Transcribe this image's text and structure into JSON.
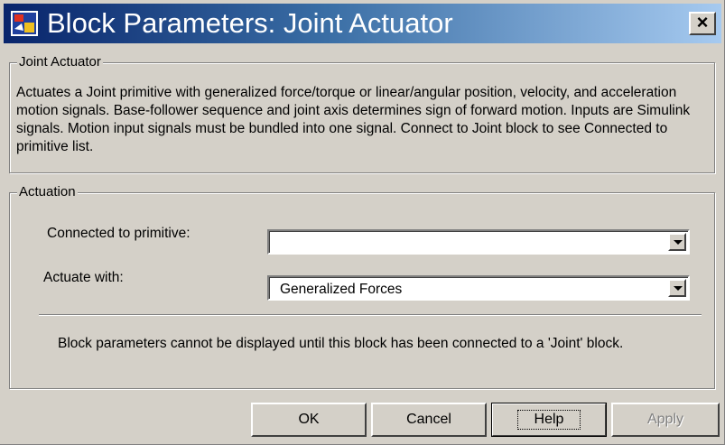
{
  "window": {
    "title": "Block Parameters: Joint Actuator",
    "close_label": "×",
    "title_bar_color": "#08246b"
  },
  "description_group": {
    "legend": "Joint Actuator",
    "text": "Actuates a Joint primitive with generalized force/torque or linear/angular position, velocity, and acceleration motion signals. Base-follower sequence and joint axis determines sign of forward motion. Inputs are Simulink signals. Motion input signals must be bundled into one signal. Connect to Joint block to see Connected to primitive list."
  },
  "actuation_group": {
    "legend": "Actuation",
    "connected_label": "Connected to primitive:",
    "connected_value": "",
    "actuate_label": "Actuate with:",
    "actuate_value": "Generalized Forces",
    "note": "Block parameters cannot be displayed until this block has been connected to a 'Joint' block."
  },
  "buttons": {
    "ok": "OK",
    "cancel": "Cancel",
    "help": "Help",
    "apply": "Apply"
  }
}
